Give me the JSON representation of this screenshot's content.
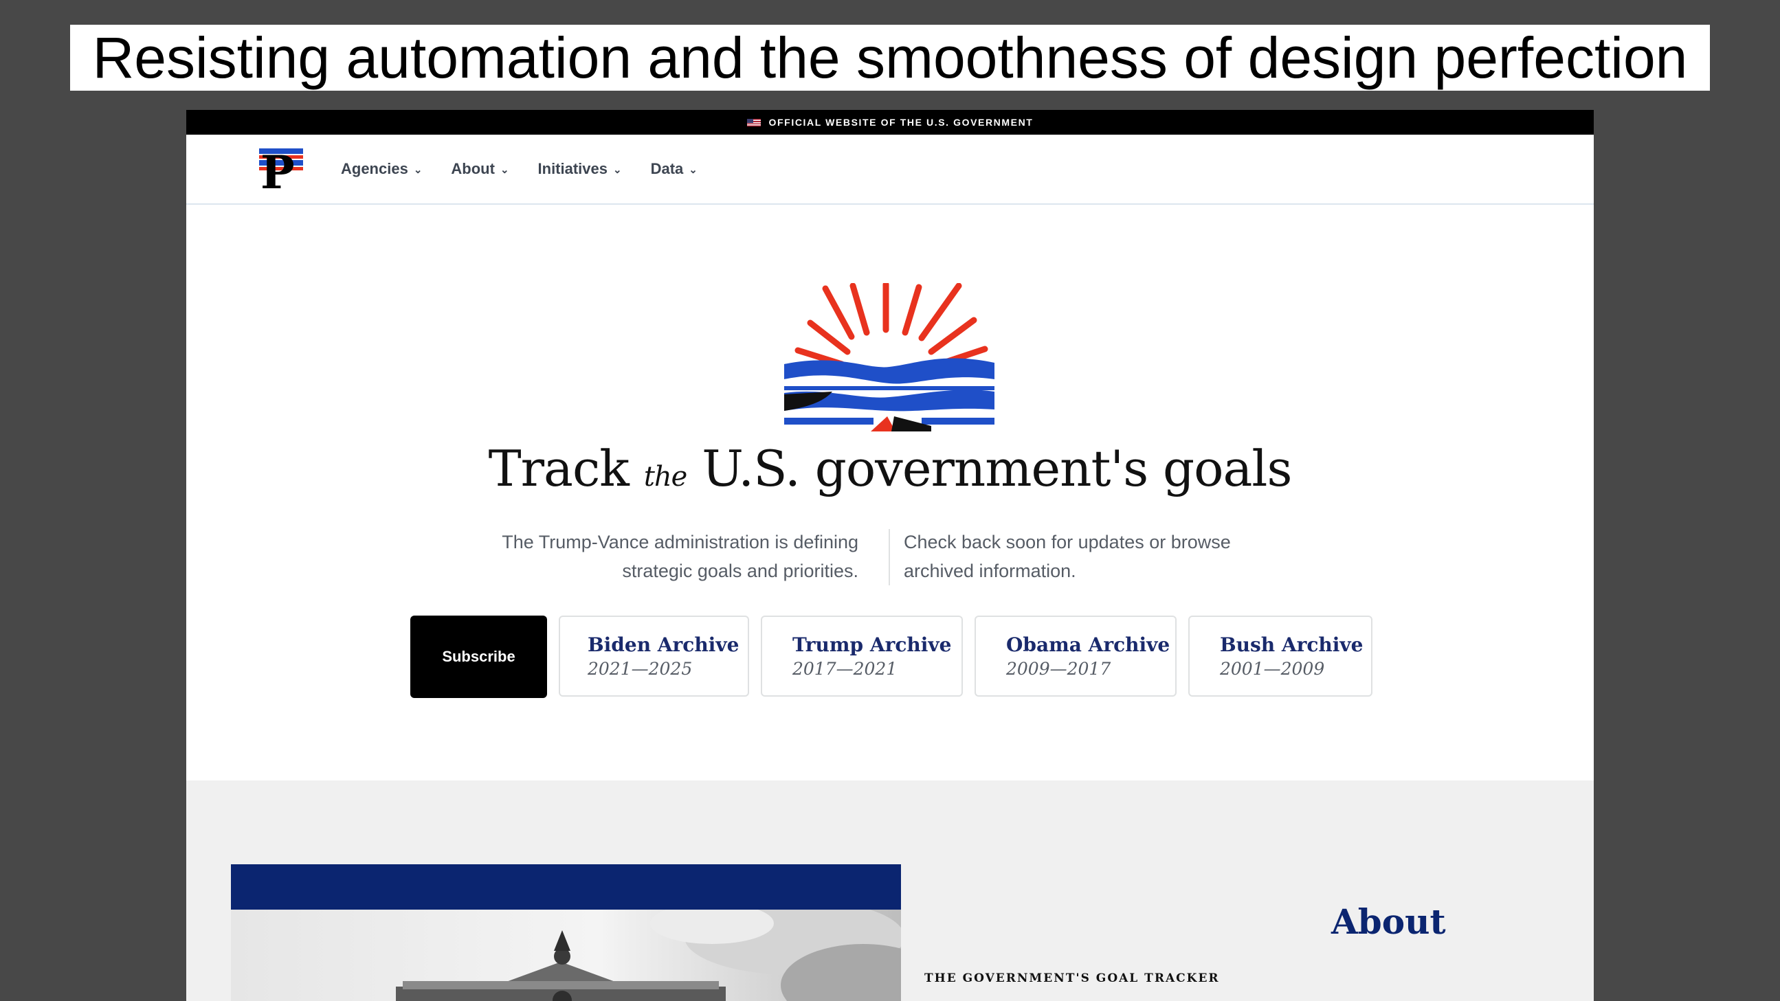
{
  "slide": {
    "title": "Resisting automation and the smoothness of design perfection"
  },
  "banner": {
    "text": "OFFICIAL WEBSITE OF THE U.S. GOVERNMENT",
    "flag_icon": "us-flag-icon"
  },
  "nav": {
    "logo_icon": "performance-gov-logo-icon",
    "items": [
      {
        "label": "Agencies"
      },
      {
        "label": "About"
      },
      {
        "label": "Initiatives"
      },
      {
        "label": "Data"
      }
    ]
  },
  "hero": {
    "title_pre": "Track",
    "title_the": "the",
    "title_post": "U.S. government's goals",
    "desc_left_line1": "The Trump-Vance administration is defining",
    "desc_left_line2": "strategic goals and priorities.",
    "desc_right_line1": "Check back soon for updates or browse",
    "desc_right_line2": "archived information.",
    "subscribe_label": "Subscribe",
    "archives": [
      {
        "name": "Biden Archive",
        "years": "2021—2025"
      },
      {
        "name": "Trump Archive",
        "years": "2017—2021"
      },
      {
        "name": "Obama Archive",
        "years": "2009—2017"
      },
      {
        "name": "Bush Archive",
        "years": "2001—2009"
      }
    ]
  },
  "about": {
    "heading": "About",
    "eyebrow": "THE GOVERNMENT'S GOAL TRACKER"
  },
  "colors": {
    "accent_navy": "#0b2570",
    "logo_red": "#e8321e",
    "logo_blue": "#1f4fc8",
    "banner_bg": "#000000"
  }
}
